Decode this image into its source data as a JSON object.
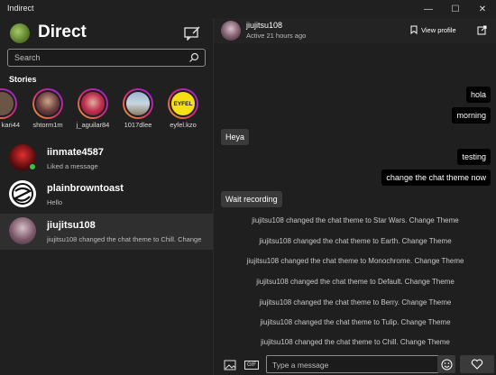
{
  "window": {
    "title": "Indirect",
    "minimize": "—",
    "maximize": "☐",
    "close": "✕"
  },
  "sidebar": {
    "title": "Direct",
    "search_placeholder": "Search",
    "stories_label": "Stories",
    "stories": [
      {
        "name": "kari44"
      },
      {
        "name": "shtorm1m"
      },
      {
        "name": "j_aguilar84"
      },
      {
        "name": "1017dlee"
      },
      {
        "name": "eyfel.kzo",
        "logo_text": "EYFEL"
      }
    ],
    "threads": [
      {
        "username": "iinmate4587",
        "preview": "Liked a message",
        "online": true
      },
      {
        "username": "plainbrowntoast",
        "preview": "Hello",
        "online": false
      },
      {
        "username": "jiujitsu108",
        "preview": "jiujitsu108 changed the chat theme to Chill. Change",
        "online": false
      }
    ]
  },
  "chat": {
    "username": "jiujitsu108",
    "status": "Active 21 hours ago",
    "view_profile_label": "View profile",
    "messages": [
      {
        "text": "hola",
        "direction": "out"
      },
      {
        "text": "morning",
        "direction": "out"
      },
      {
        "text": "Heya",
        "direction": "in"
      },
      {
        "text": "testing",
        "direction": "out"
      },
      {
        "text": "change the chat theme now",
        "direction": "out"
      },
      {
        "text": "Wait recording",
        "direction": "in"
      }
    ],
    "system_messages": [
      "jiujitsu108 changed the chat theme to Star Wars. Change Theme",
      "jiujitsu108 changed the chat theme to Earth. Change Theme",
      "jiujitsu108 changed the chat theme to Monochrome. Change Theme",
      "jiujitsu108 changed the chat theme to Default. Change Theme",
      "jiujitsu108 changed the chat theme to Berry. Change Theme",
      "jiujitsu108 changed the chat theme to Tulip. Change Theme",
      "jiujitsu108 changed the chat theme to Chill. Change Theme"
    ],
    "composer": {
      "placeholder": "Type a message",
      "gif_label": "GIF"
    }
  },
  "colors": {
    "background": "#1f1f1f",
    "selected_thread": "#2f2f2f",
    "outgoing_bubble": "#000000",
    "incoming_bubble": "#3a3a3a",
    "online": "#3fbf3f"
  }
}
